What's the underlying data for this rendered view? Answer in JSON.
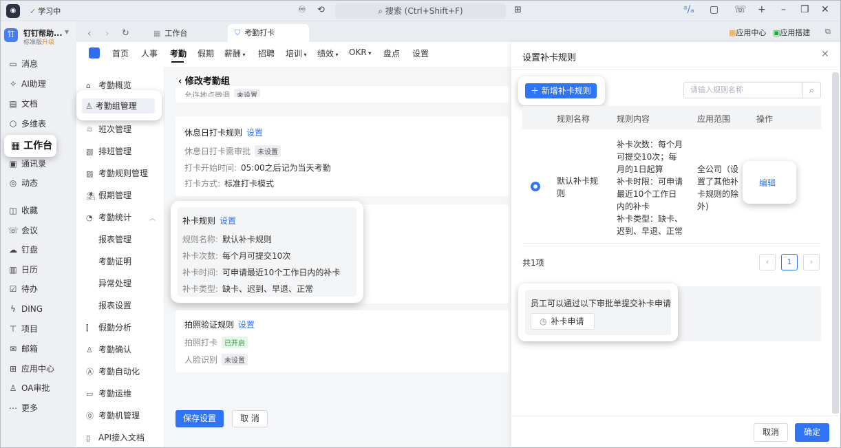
{
  "titlebar": {
    "study": "学习中",
    "search": "搜索 (Ctrl+Shift+F)"
  },
  "org": {
    "name": "钉钉帮助...",
    "version": "标准版",
    "upgrade": "升级"
  },
  "nav": {
    "items": [
      "消息",
      "AI助理",
      "文档",
      "多维表",
      "工作台",
      "通讯录",
      "动态",
      "收藏",
      "会议",
      "钉盘",
      "日历",
      "待办",
      "DING",
      "项目",
      "邮箱",
      "应用中心",
      "OA审批",
      "更多"
    ],
    "active": "工作台"
  },
  "tabs": {
    "t1": "工作台",
    "t2": "考勤打卡"
  },
  "toolbar": {
    "app_center": "应用中心",
    "app_build": "应用搭建"
  },
  "topnav": [
    "首页",
    "人事",
    "考勤",
    "假期",
    "薪酬",
    "招聘",
    "培训",
    "绩效",
    "OKR",
    "盘点",
    "设置"
  ],
  "side": {
    "items": [
      "考勤概览",
      "考勤组管理",
      "班次管理",
      "排班管理",
      "考勤规则管理",
      "假期管理",
      "考勤统计"
    ],
    "subs": [
      "报表管理",
      "考勤证明",
      "异常处理",
      "报表设置"
    ],
    "items2": [
      "假勤分析",
      "考勤确认",
      "考勤自动化",
      "考勤运维",
      "考勤机管理",
      "API接入文档"
    ]
  },
  "main": {
    "header": "修改考勤组",
    "partial_label": "允许地点微调",
    "partial_badge": "未设置",
    "rest": {
      "title": "休息日打卡规则",
      "link": "设置",
      "r1_label": "休息日打卡需审批",
      "r1_badge": "未设置",
      "r2_label": "打卡开始时间:",
      "r2_value": "05:00之后记为当天考勤",
      "r3_label": "打卡方式:",
      "r3_value": "标准打卡模式"
    },
    "makeup": {
      "title": "补卡规则",
      "link": "设置",
      "r1_label": "规则名称:",
      "r1_value": "默认补卡规则",
      "r2_label": "补卡次数:",
      "r2_value": "每个月可提交10次",
      "r3_label": "补卡时间:",
      "r3_value": "可申请最近10个工作日内的补卡",
      "r4_label": "补卡类型:",
      "r4_value": "缺卡、迟到、早退、正常"
    },
    "photo": {
      "title": "拍照验证规则",
      "link": "设置",
      "r1_label": "拍照打卡",
      "r1_badge": "已开启",
      "r2_label": "人脸识别",
      "r2_badge": "未设置"
    },
    "save": "保存设置",
    "cancel": "取 消"
  },
  "drawer": {
    "title": "设置补卡规则",
    "new_rule": "新增补卡规则",
    "search_placeholder": "请输入规则名称",
    "columns": [
      "规则名称",
      "规则内容",
      "应用范围",
      "操作"
    ],
    "row": {
      "name_l1": "默认补卡规",
      "name_l2": "则",
      "content": [
        "补卡次数：每个月",
        "可提交10次；每",
        "月的1日起算",
        "补卡时限：可申请",
        "最近10个工作日",
        "内的补卡",
        "补卡类型：缺卡、",
        "迟到、早退、正常"
      ],
      "scope": [
        "全公司（设",
        "置了其他补",
        "卡规则的除",
        "外)"
      ],
      "action": "编辑"
    },
    "total": "共1项",
    "page": "1",
    "apply_text": "员工可以通过以下审批单提交补卡申请",
    "apply_btn": "补卡申请",
    "cancel": "取消",
    "ok": "确定"
  }
}
